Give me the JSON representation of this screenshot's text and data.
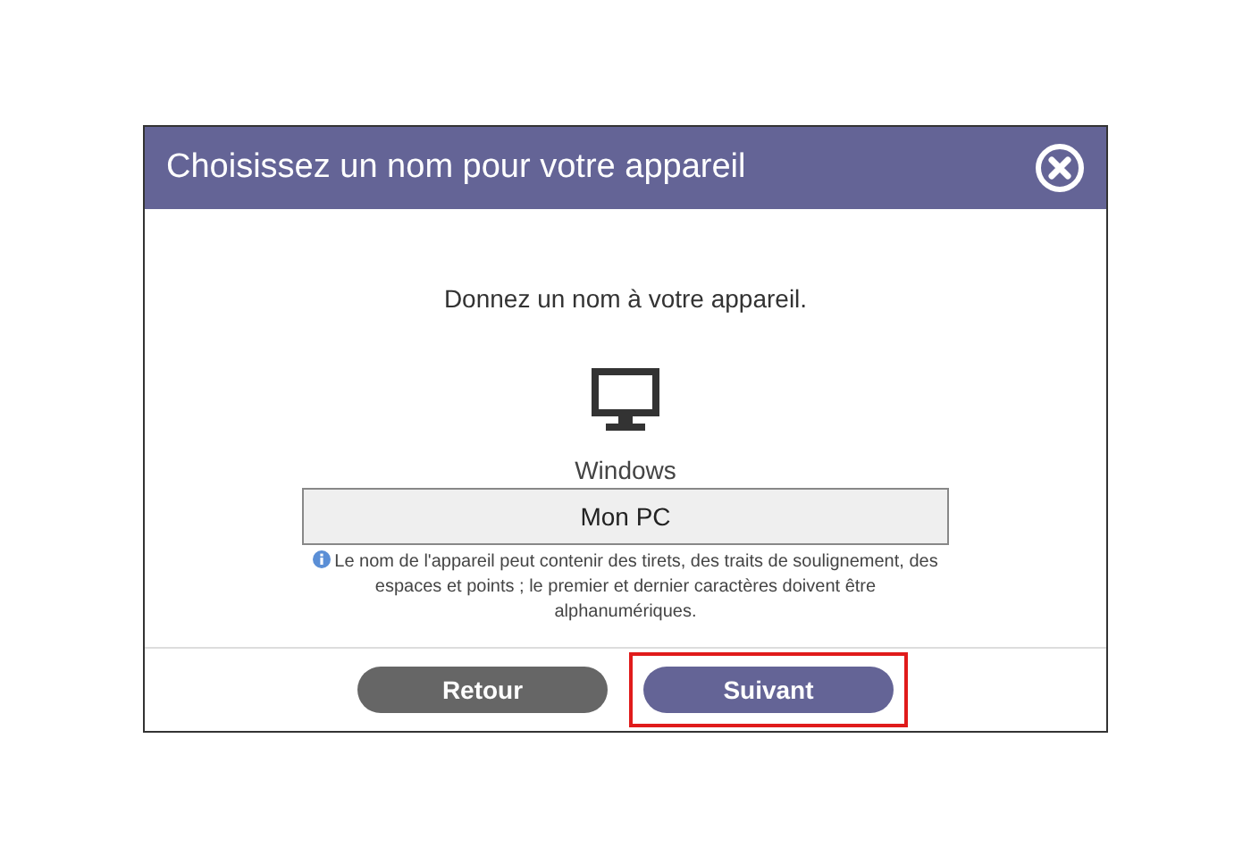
{
  "dialog": {
    "title": "Choisissez un nom pour votre appareil",
    "prompt": "Donnez un nom à votre appareil.",
    "device_label": "Windows",
    "name_field": {
      "value": "Mon PC"
    },
    "hint": "Le nom de l'appareil peut contenir des tirets, des traits de soulignement, des espaces et points ; le premier et dernier caractères doivent être alphanumériques.",
    "buttons": [
      {
        "label": "Retour",
        "kind": "secondary",
        "highlighted": false
      },
      {
        "label": "Suivant",
        "kind": "primary",
        "highlighted": true
      }
    ]
  }
}
